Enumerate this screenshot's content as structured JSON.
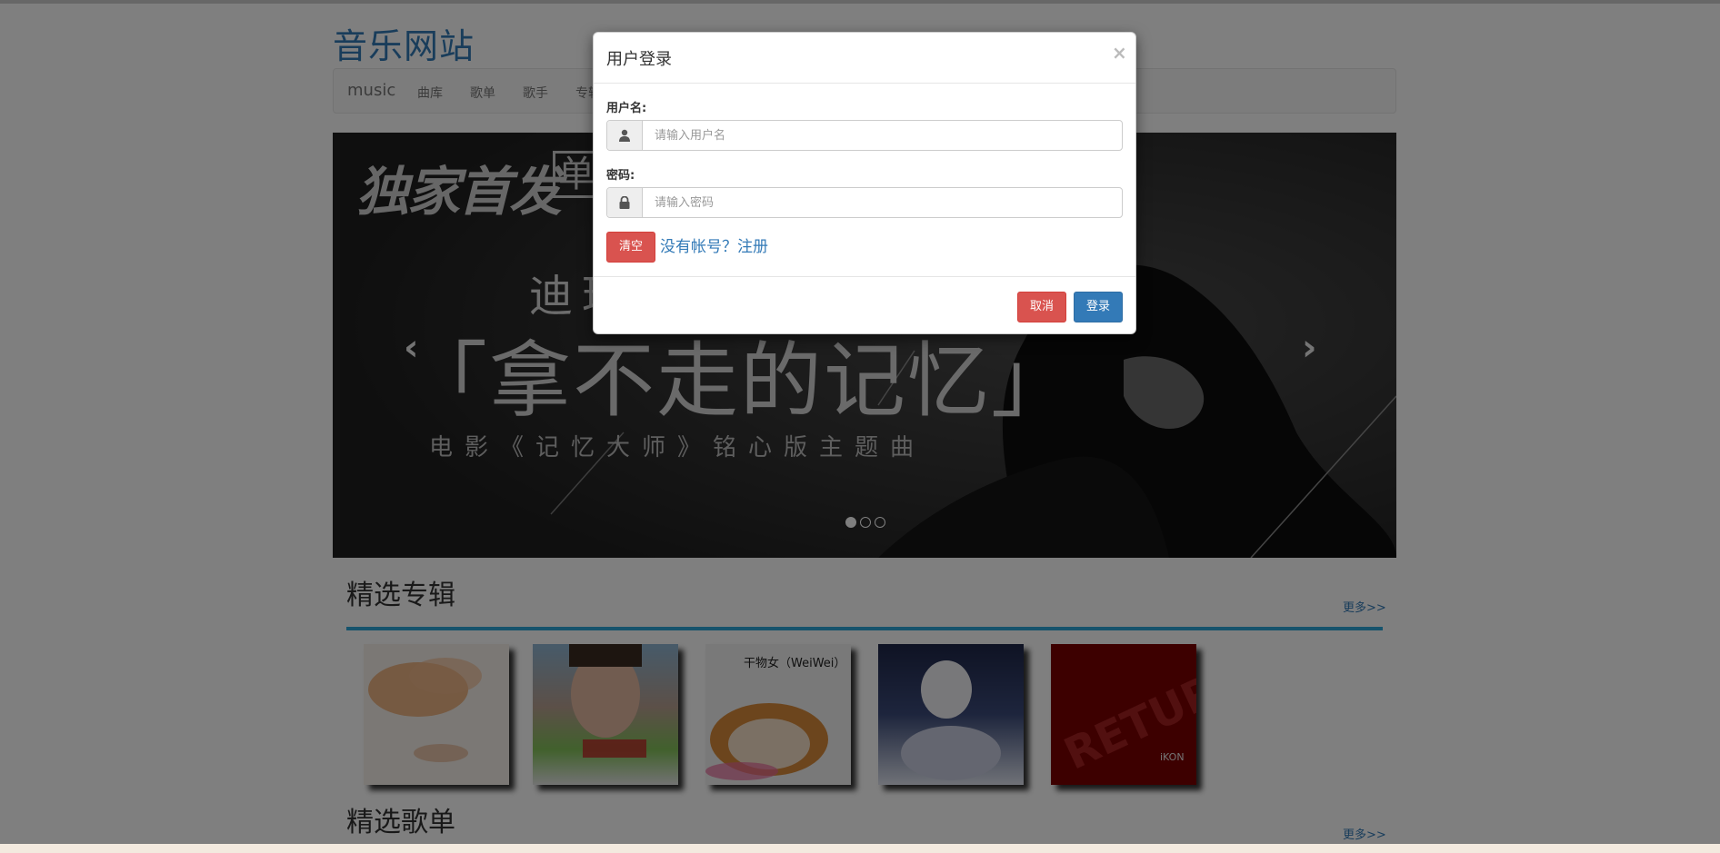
{
  "site": {
    "title": "音乐网站"
  },
  "navbar": {
    "brand": "music",
    "items": [
      "曲库",
      "歌单",
      "歌手",
      "专辑"
    ]
  },
  "carousel": {
    "badge_text": "独家首发",
    "badge_single": "单",
    "artist": "迪玛希",
    "song_title": "「拿不走的记忆」",
    "subtitle": "电影《记忆大师》铭心版主题曲",
    "slide_count": 3,
    "active_slide": 1
  },
  "sections": {
    "albums_title": "精选专辑",
    "albums_more": "更多>>",
    "playlists_title": "精选歌单",
    "playlists_more": "更多>>"
  },
  "albums": {
    "a3_caption": "干物女（WeiWei）",
    "a5_caption": "RETURN",
    "a5_artist": "iKON"
  },
  "login_modal": {
    "title": "用户登录",
    "close_symbol": "×",
    "username_label": "用户名:",
    "username_placeholder": "请输入用户名",
    "password_label": "密码:",
    "password_placeholder": "请输入密码",
    "clear_button": "清空",
    "register_link": "没有帐号？注册",
    "cancel_button": "取消",
    "login_button": "登录"
  },
  "colors": {
    "link": "#337ab7",
    "danger": "#d9534f",
    "primary": "#337ab7",
    "section_line": "#2ca7d9"
  }
}
